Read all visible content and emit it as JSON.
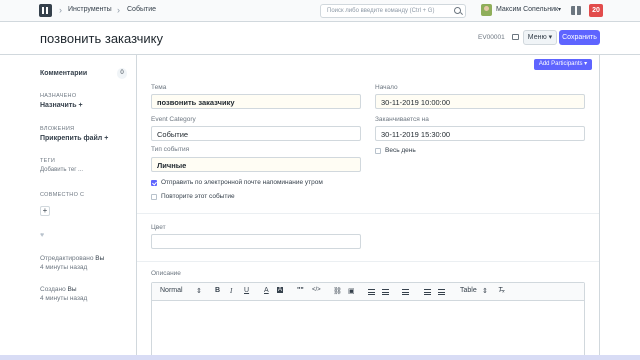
{
  "navbar": {
    "breadcrumbs": [
      "Инструменты",
      "Событие"
    ],
    "search_placeholder": "Поиск либо введите команду (Ctrl + G)",
    "user_name": "Максим Сопельник",
    "notification_count": "20"
  },
  "page": {
    "title": "позвонить заказчику",
    "doc_id": "EV00001",
    "menu_label": "Меню",
    "save_label": "Сохранить"
  },
  "sidebar": {
    "comments_label": "Комментарии",
    "comments_count": "0",
    "assigned_heading": "НАЗНАЧЕНО",
    "assign_action": "Назначить +",
    "attachments_heading": "ВЛОЖЕНИЯ",
    "attach_action": "Прикрепить файл +",
    "tags_heading": "ТЕГИ",
    "add_tag": "Добавить тег ...",
    "shared_heading": "СОВМЕСТНО С",
    "shared_add": "+",
    "modified_label": "Отредактировано",
    "modified_by": "Вы",
    "modified_time": "4 минуты назад",
    "created_label": "Создано",
    "created_by": "Вы",
    "created_time": "4 минуты назад"
  },
  "form": {
    "add_participants": "Add Participants ▾",
    "subject_label": "Тема",
    "subject_value": "позвонить заказчику",
    "category_label": "Event Category",
    "category_value": "Событие",
    "type_label": "Тип события",
    "type_value": "Личные",
    "send_reminder_label": "Отправить по электронной почте напоминание утром",
    "send_reminder_checked": true,
    "repeat_label": "Повторите этот событие",
    "repeat_checked": false,
    "starts_label": "Начало",
    "starts_value": "30-11-2019 10:00:00",
    "ends_label": "Заканчивается на",
    "ends_value": "30-11-2019 15:30:00",
    "all_day_label": "Весь день",
    "all_day_checked": false,
    "color_label": "Цвет",
    "color_value": "",
    "description_label": "Описание"
  },
  "editor_toolbar": {
    "style_select": "Normal",
    "bold": "B",
    "italic": "I",
    "underline": "U",
    "text_color": "A",
    "quote": "\"\"",
    "code": "</>",
    "table_select": "Table"
  },
  "colors": {
    "primary": "#5e64ff",
    "notification": "#e24c4c",
    "border": "#d1d8dd"
  }
}
